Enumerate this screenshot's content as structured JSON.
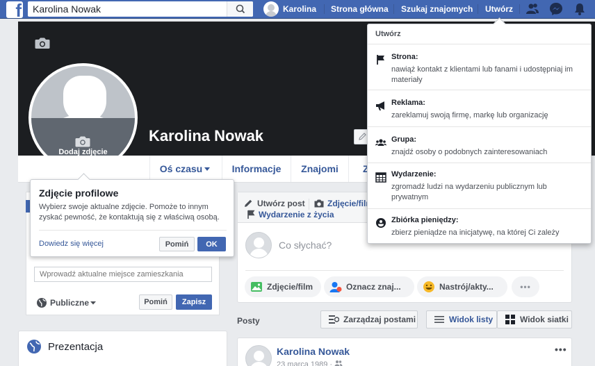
{
  "topbar": {
    "logo": "f",
    "search_value": "Karolina Nowak",
    "user_name": "Karolina",
    "nav_home": "Strona główna",
    "nav_find_friends": "Szukaj znajomych",
    "nav_create": "Utwórz",
    "icons": [
      "friend-requests-icon",
      "messenger-icon",
      "notifications-icon"
    ]
  },
  "profile": {
    "name": "Karolina Nowak",
    "add_photo_label": "Dodaj zdjęcie"
  },
  "tabs": [
    "Oś czasu",
    "Informacje",
    "Znajomi",
    "Z"
  ],
  "tooltip": {
    "title": "Zdjęcie profilowe",
    "body": "Wybierz swoje aktualne zdjęcie. Pomoże to innym zyskać pewność, że kontaktują się z właściwą osobą.",
    "link": "Dowiedz się więcej",
    "skip": "Pomiń",
    "ok": "OK"
  },
  "intro": {
    "city_placeholder": "Wprowadź aktualne miejsce zamieszkania",
    "privacy": "Publiczne",
    "skip": "Pomiń",
    "save": "Zapisz"
  },
  "presentation": {
    "title": "Prezentacja"
  },
  "composer": {
    "tab_post": "Utwórz post",
    "tab_photo": "Zdjęcie/film",
    "tab_event": "Wydarzenie z życia",
    "placeholder": "Co słychać?",
    "pill_photo": "Zdjęcie/film",
    "pill_tag": "Oznacz znaj...",
    "pill_feeling": "Nastrój/akty...",
    "pill_more": "•••"
  },
  "posts": {
    "label": "Posty",
    "manage": "Zarządzaj postami",
    "list_view": "Widok listy",
    "grid_view": "Widok siatki"
  },
  "post": {
    "author": "Karolina Nowak",
    "date": "23 marca 1989 · ",
    "more": "•••"
  },
  "dropdown": {
    "header": "Utwórz",
    "items": [
      {
        "icon": "flag-icon",
        "title": "Strona:",
        "desc": "nawiąż kontakt z klientami lub fanami i udostępniaj im materiały"
      },
      {
        "icon": "megaphone-icon",
        "title": "Reklama:",
        "desc": "zareklamuj swoją firmę, markę lub organizację"
      },
      {
        "icon": "group-icon",
        "title": "Grupa:",
        "desc": "znajdź osoby o podobnych zainteresowaniach"
      },
      {
        "icon": "calendar-icon",
        "title": "Wydarzenie:",
        "desc": "zgromadź ludzi na wydarzeniu publicznym lub prywatnym"
      },
      {
        "icon": "fundraiser-icon",
        "title": "Zbiórka pieniędzy:",
        "desc": "zbierz pieniądze na inicjatywę, na której Ci zależy"
      }
    ]
  },
  "colors": {
    "brand_blue": "#4267b2",
    "link_blue": "#365899",
    "cover_dark": "#1c1e21",
    "background": "#e9ebee"
  }
}
